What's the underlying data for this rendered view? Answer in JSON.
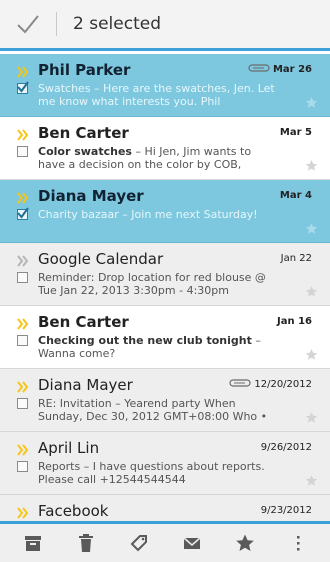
{
  "action_bar": {
    "selected_label": "2 selected"
  },
  "emails": [
    {
      "sender": "Phil Parker",
      "subject": "",
      "snippet": "Swatches – Here are the swatches, Jen. Let me know what interests you. Phil",
      "date": "Mar 26",
      "selected": true,
      "read": false,
      "important": true,
      "attachment": true
    },
    {
      "sender": "Ben Carter",
      "subject": "Color swatches",
      "snippet": " – Hi Jen, Jim wants to have a decision on the color by COB,",
      "date": "Mar 5",
      "selected": false,
      "read": false,
      "important": true,
      "attachment": false
    },
    {
      "sender": "Diana Mayer",
      "subject": "",
      "snippet": "Charity bazaar – Join me next Saturday!",
      "date": "Mar 4",
      "selected": true,
      "read": false,
      "important": true,
      "attachment": false
    },
    {
      "sender": "Google Calendar",
      "subject": "",
      "snippet": "Reminder: Drop location for red blouse @ Tue Jan 22, 2013 3:30pm - 4:30pm",
      "date": "Jan 22",
      "selected": false,
      "read": true,
      "important": false,
      "attachment": false
    },
    {
      "sender": "Ben Carter",
      "subject": "Checking out the new club tonight",
      "snippet": " – Wanna come?",
      "date": "Jan 16",
      "selected": false,
      "read": false,
      "important": true,
      "attachment": false
    },
    {
      "sender": "Diana Mayer",
      "subject": "",
      "snippet": "RE: Invitation – Yearend party When Sunday, Dec 30, 2012 GMT+08:00 Who •",
      "date": "12/20/2012",
      "selected": false,
      "read": true,
      "important": true,
      "attachment": true
    },
    {
      "sender": "April Lin",
      "subject": "",
      "snippet": "Reports – I have questions about reports. Please call +12544544544",
      "date": "9/26/2012",
      "selected": false,
      "read": true,
      "important": true,
      "attachment": false
    },
    {
      "sender": "Facebook",
      "subject": "",
      "snippet": "",
      "date": "9/23/2012",
      "selected": false,
      "read": true,
      "important": true,
      "attachment": false
    }
  ],
  "bottom_bar": {
    "icons": [
      "archive-icon",
      "delete-icon",
      "label-icon",
      "mark-unread-icon",
      "star-icon",
      "overflow-menu-icon"
    ]
  },
  "colors": {
    "accent": "#3aa0d6",
    "selected_row": "#7ec8df",
    "important_marker": "#f5c518"
  }
}
